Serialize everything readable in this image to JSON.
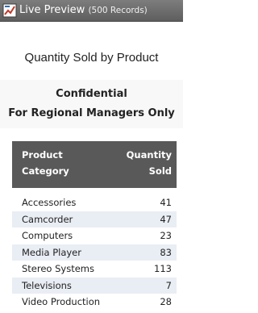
{
  "window": {
    "title": "Live Preview",
    "subtitle": "(500 Records)"
  },
  "report": {
    "title": "Quantity Sold by Product",
    "confidential": "Confidential",
    "audience": "For Regional Managers Only"
  },
  "table": {
    "header_category": [
      "Product",
      "Category"
    ],
    "header_quantity": [
      "Quantity",
      "Sold"
    ],
    "rows": [
      {
        "category": "Accessories",
        "quantity": "41"
      },
      {
        "category": "Camcorder",
        "quantity": "47"
      },
      {
        "category": "Computers",
        "quantity": "23"
      },
      {
        "category": "Media Player",
        "quantity": "83"
      },
      {
        "category": "Stereo Systems",
        "quantity": "113"
      },
      {
        "category": "Televisions",
        "quantity": "7"
      },
      {
        "category": "Video Production",
        "quantity": "28"
      }
    ]
  },
  "colors": {
    "titlebar": "#6e6e6e",
    "header": "#595959",
    "alt_row": "#e9edf4"
  }
}
